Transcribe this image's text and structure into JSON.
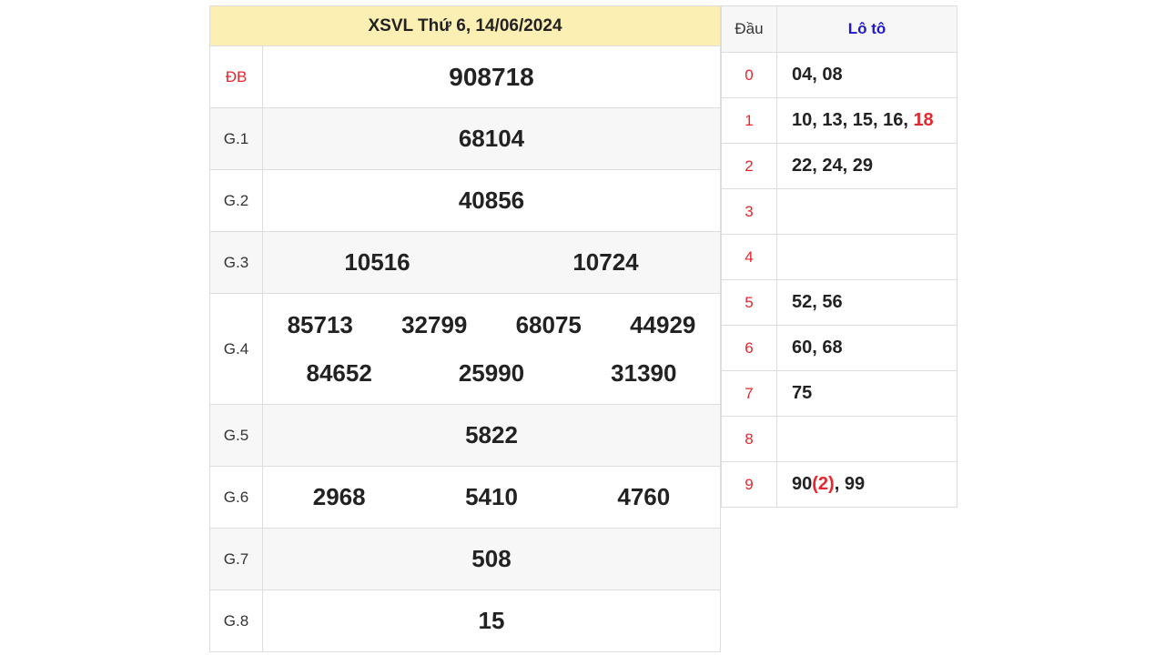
{
  "results": {
    "title": "XSVL Thứ 6, 14/06/2024",
    "prizes": [
      {
        "label": "ĐB",
        "values": [
          "908718"
        ]
      },
      {
        "label": "G.1",
        "values": [
          "68104"
        ]
      },
      {
        "label": "G.2",
        "values": [
          "40856"
        ]
      },
      {
        "label": "G.3",
        "values": [
          "10516",
          "10724"
        ]
      },
      {
        "label": "G.4",
        "values": [
          "85713",
          "32799",
          "68075",
          "44929",
          "84652",
          "25990",
          "31390"
        ]
      },
      {
        "label": "G.5",
        "values": [
          "5822"
        ]
      },
      {
        "label": "G.6",
        "values": [
          "2968",
          "5410",
          "4760"
        ]
      },
      {
        "label": "G.7",
        "values": [
          "508"
        ]
      },
      {
        "label": "G.8",
        "values": [
          "15"
        ]
      }
    ]
  },
  "loto": {
    "header_dau": "Đầu",
    "header_loto": "Lô tô",
    "rows": [
      {
        "dau": "0",
        "text": "04, 08"
      },
      {
        "dau": "1",
        "text": "10, 13, 15, 16, ",
        "highlight": "18"
      },
      {
        "dau": "2",
        "text": "22, 24, 29"
      },
      {
        "dau": "3",
        "text": ""
      },
      {
        "dau": "4",
        "text": ""
      },
      {
        "dau": "5",
        "text": "52, 56"
      },
      {
        "dau": "6",
        "text": "60, 68"
      },
      {
        "dau": "7",
        "text": "75"
      },
      {
        "dau": "8",
        "text": ""
      },
      {
        "dau": "9",
        "text": "90",
        "highlight": "(2)",
        "after": ", 99"
      }
    ]
  },
  "colors": {
    "accent_red": "#e8262d",
    "header_blue": "#1f19c9",
    "title_bg": "#fcefb4"
  }
}
